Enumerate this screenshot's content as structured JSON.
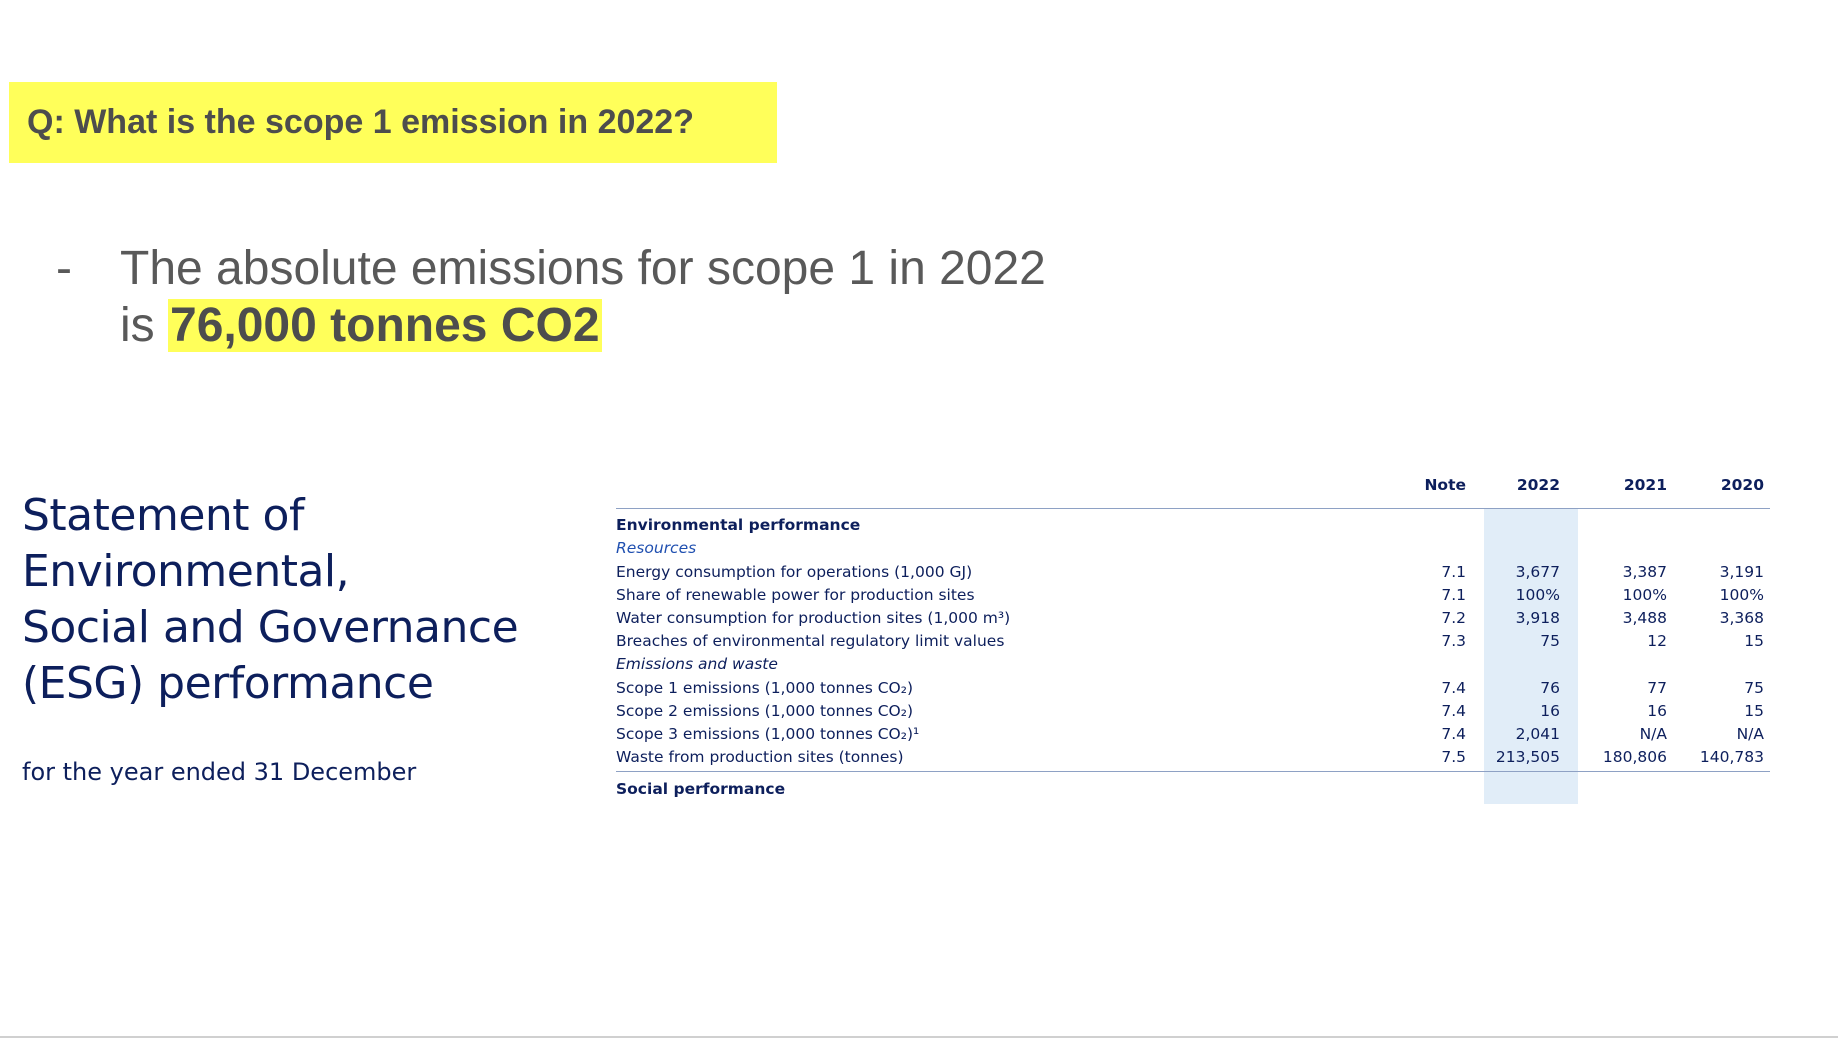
{
  "question": "Q: What is the scope 1 emission in 2022?",
  "answer": {
    "dash": "-",
    "line1": "The absolute emissions for scope 1 in 2022",
    "line2_prefix": "is ",
    "line2_highlight": "76,000 tonnes CO2"
  },
  "statement": {
    "title_lines": [
      "Statement of",
      "Environmental,",
      "Social and Governance",
      "(ESG) performance"
    ],
    "subtitle": "for the year ended 31 December"
  },
  "table": {
    "headers": {
      "label": "",
      "note": "Note",
      "y2022": "2022",
      "y2021": "2021",
      "y2020": "2020"
    },
    "section_environmental": "Environmental performance",
    "subsection_resources": "Resources",
    "resources_rows": [
      {
        "label": "Energy consumption for operations (1,000 GJ)",
        "note": "7.1",
        "y2022": "3,677",
        "y2021": "3,387",
        "y2020": "3,191"
      },
      {
        "label": "Share of renewable power for production sites",
        "note": "7.1",
        "y2022": "100%",
        "y2021": "100%",
        "y2020": "100%"
      },
      {
        "label": "Water consumption for production sites (1,000 m³)",
        "note": "7.2",
        "y2022": "3,918",
        "y2021": "3,488",
        "y2020": "3,368"
      },
      {
        "label": "Breaches of environmental regulatory limit values",
        "note": "7.3",
        "y2022": "75",
        "y2021": "12",
        "y2020": "15"
      }
    ],
    "subsection_emissions": "Emissions and waste",
    "emissions_rows": [
      {
        "label": "Scope 1 emissions (1,000 tonnes CO₂)",
        "note": "7.4",
        "y2022": "76",
        "y2021": "77",
        "y2020": "75"
      },
      {
        "label": "Scope 2 emissions (1,000 tonnes CO₂)",
        "note": "7.4",
        "y2022": "16",
        "y2021": "16",
        "y2020": "15"
      },
      {
        "label": "Scope 3 emissions (1,000 tonnes CO₂)¹",
        "note": "7.4",
        "y2022": "2,041",
        "y2021": "N/A",
        "y2020": "N/A"
      },
      {
        "label": "Waste from production sites (tonnes)",
        "note": "7.5",
        "y2022": "213,505",
        "y2021": "180,806",
        "y2020": "140,783"
      }
    ],
    "section_social": "Social performance"
  },
  "colors": {
    "highlight": "#ffff5a",
    "navy": "#0d1f5c",
    "column_highlight": "#e1edf8",
    "resources_blue": "#1f4fb0"
  }
}
